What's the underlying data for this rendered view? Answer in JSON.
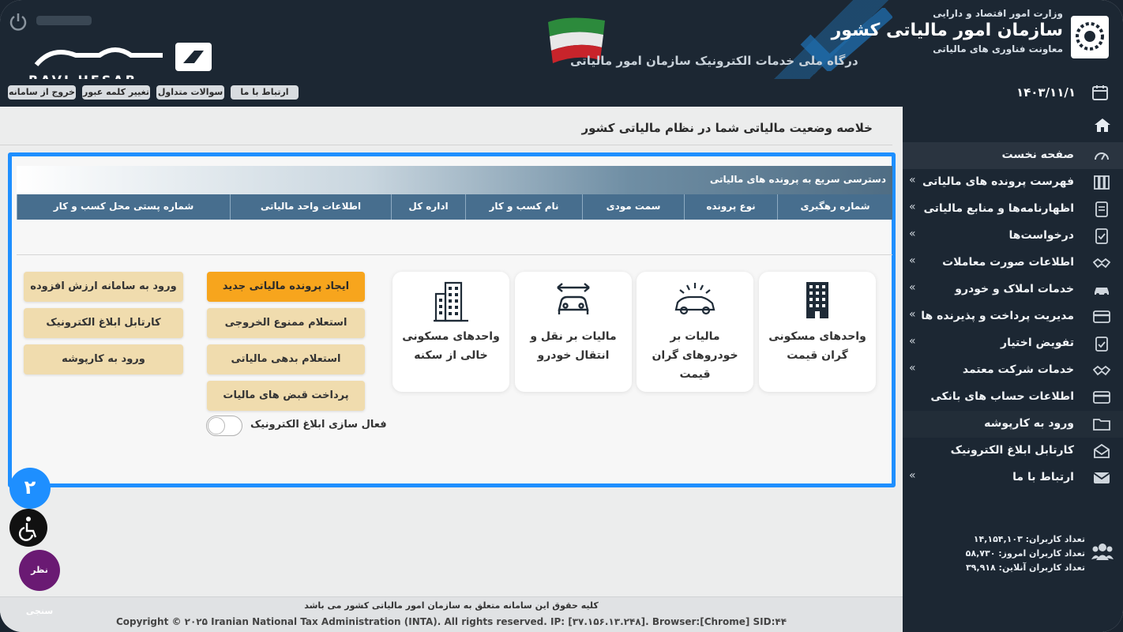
{
  "header": {
    "ministry": "وزارت امور اقتصاد و دارایی",
    "org_name": "سازمان امور مالیاتی کشور",
    "deputy": "معاونت فناوری های مالیاتی",
    "portal": "درگاه ملی خدمات الکترونیک سازمان امور مالیاتی",
    "logo_text": "RAVI HESAB"
  },
  "topbar": {
    "contact": "ارتباط با ما",
    "faq": "سوالات متداول",
    "change_password": "تغییر کلمه عبور",
    "logout": "خروج از سامانه"
  },
  "sidebar": {
    "date": "۱۴۰۳/۱۱/۱",
    "items": [
      {
        "label": "صفحه نخست",
        "icon": "dashboard-icon",
        "arrow": false
      },
      {
        "label": "فهرست پرونده های مالیاتی",
        "icon": "files-icon",
        "arrow": true
      },
      {
        "label": "اظهارنامه‌ها و منابع مالیاتی",
        "icon": "document-icon",
        "arrow": true
      },
      {
        "label": "درخواست‌ها",
        "icon": "checklist-icon",
        "arrow": true
      },
      {
        "label": "اطلاعات صورت معاملات",
        "icon": "handshake-icon",
        "arrow": true
      },
      {
        "label": "خدمات املاک و خودرو",
        "icon": "car-icon",
        "arrow": true
      },
      {
        "label": "مدیریت پرداخت و پذیرنده ها",
        "icon": "card-icon",
        "arrow": true
      },
      {
        "label": "تفویض اختیار",
        "icon": "clipboard-check-icon",
        "arrow": true
      },
      {
        "label": "خدمات شرکت معتمد",
        "icon": "handshake-icon",
        "arrow": true
      },
      {
        "label": "اطلاعات حساب های بانکی",
        "icon": "bank-card-icon",
        "arrow": false
      },
      {
        "label": "ورود به کارپوشه",
        "icon": "folder-icon",
        "arrow": false
      },
      {
        "label": "کارتابل ابلاغ الکترونیک",
        "icon": "mail-icon",
        "arrow": false
      },
      {
        "label": "ارتباط با ما",
        "icon": "envelope-icon",
        "arrow": true
      }
    ],
    "stats": {
      "total": "تعداد کاربران: ۱۴,۱۵۴,۱۰۳",
      "today": "تعداد کاربران امروز: ۵۸,۷۳۰",
      "online": "تعداد کاربران آنلاین: ۳۹,۹۱۸"
    }
  },
  "main": {
    "page_title": "خلاصه وضعیت مالیاتی شما در نظام مالیاتی کشور",
    "quick_access_title": "دسترسی سریع به پرونده های مالیاتی",
    "table_headers": [
      "شماره رهگیری",
      "نوع پرونده",
      "سمت مودی",
      "نام کسب و کار",
      "اداره کل",
      "اطلاعات واحد مالیاتی",
      "شماره پستی محل کسب و کار"
    ],
    "cards": [
      "واحدهای مسکونی گران قیمت",
      "مالیات بر خودروهای گران قیمت",
      "مالیات بر نقل و انتقال خودرو",
      "واحدهای مسکونی خالی از سکنه"
    ],
    "middle_buttons": [
      "ایجاد پرونده مالیاتی جدید",
      "استعلام ممنوع الخروجی",
      "استعلام بدهی مالیاتی",
      "پرداخت قبض های مالیات"
    ],
    "left_buttons": [
      "ورود به سامانه ارزش افزوده",
      "کارتابل ابلاغ الکترونیک",
      "ورود به کارپوشه"
    ],
    "toggle_label": "فعال سازی ابلاغ الکترونیک",
    "toggle_on": false
  },
  "footer": {
    "rights": "کلیه حقوق این سامانه متعلق به سازمان امور مالیاتی کشور می باشد",
    "copyright": "Copyright © ۲۰۲۵ Iranian National Tax Administration (INTA). All rights reserved. IP: [۳۷.۱۵۶.۱۳.۲۴۸]. Browser:[Chrome] SID:۴۴"
  },
  "floaters": {
    "step": "۲",
    "survey": "نظر سنجی"
  },
  "colors": {
    "accent": "#1e8fff",
    "orange_button": "#f7a51d",
    "beige_button": "#f0dcae",
    "dark_bg": "#1c2733",
    "table_header": "#476e8e"
  }
}
